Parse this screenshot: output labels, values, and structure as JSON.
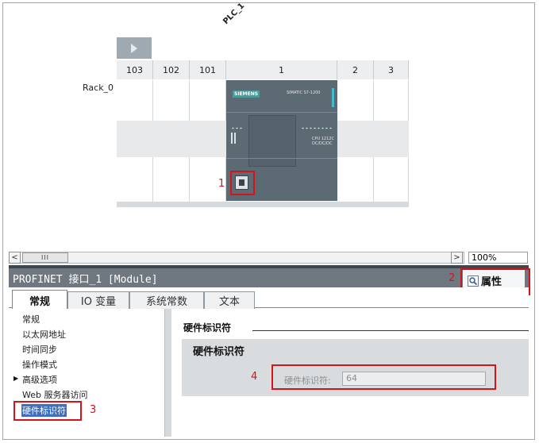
{
  "device": {
    "plc_name": "PLC_1",
    "rack_label": "Rack_0",
    "slots": [
      "103",
      "102",
      "101",
      "1",
      "2",
      "3"
    ],
    "cpu": {
      "brand": "SIEMENS",
      "model": "SIMATIC S7-1200",
      "cpu_line1": "CPU 1212C",
      "cpu_line2": "DC/DC/DC"
    }
  },
  "annotations": {
    "n1": "1",
    "n2": "2",
    "n3": "3",
    "n4": "4"
  },
  "scrollbar": {
    "left_arrow": "<",
    "right_arrow": ">",
    "thumb_grip": "III",
    "zoom": "100%"
  },
  "inspector": {
    "title": "PROFINET 接口_1 [Module]",
    "properties_tab": "属性",
    "tabs": [
      "常规",
      "IO 变量",
      "系统常数",
      "文本"
    ],
    "nav": [
      "常规",
      "以太网地址",
      "时间同步",
      "操作模式",
      "高级选项",
      "Web 服务器访问",
      "硬件标识符"
    ],
    "section_title": "硬件标识符",
    "panel_title": "硬件标识符",
    "field_label": "硬件标识符:",
    "field_value": "64"
  },
  "colors": {
    "annotation_red": "#d4141b",
    "selection_blue": "#3e6ec0",
    "title_bar": "#6f7880"
  }
}
